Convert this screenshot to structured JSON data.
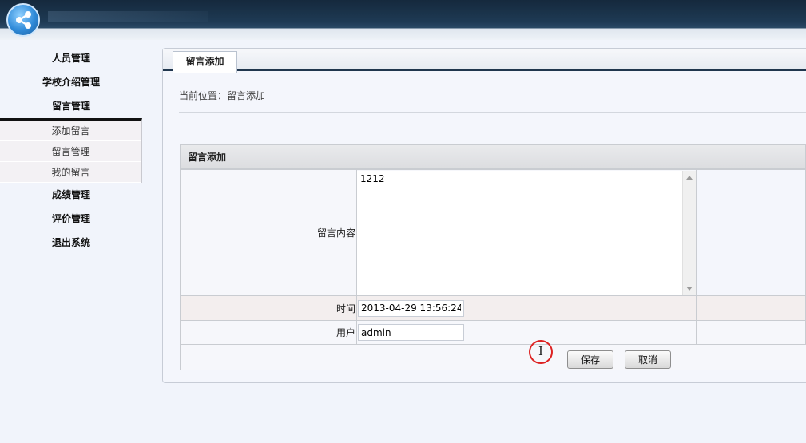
{
  "sidebar": {
    "items_top": [
      {
        "label": "人员管理"
      },
      {
        "label": "学校介绍管理"
      },
      {
        "label": "留言管理"
      }
    ],
    "submenu": [
      {
        "label": "添加留言"
      },
      {
        "label": "留言管理"
      },
      {
        "label": "我的留言"
      }
    ],
    "items_bottom": [
      {
        "label": "成绩管理"
      },
      {
        "label": "评价管理"
      },
      {
        "label": "退出系统"
      }
    ]
  },
  "main": {
    "tab_label": "留言添加",
    "breadcrumb": "当前位置：留言添加",
    "form": {
      "title": "留言添加",
      "content_label": "留言内容",
      "content_value": "1212",
      "time_label": "时间",
      "time_value": "2013-04-29 13:56:24",
      "user_label": "用户",
      "user_value": "admin",
      "save_label": "保存",
      "cancel_label": "取消"
    }
  },
  "cursor_glyph": "I",
  "colors": {
    "header_dark": "#15293d",
    "tab_underline": "#20364e",
    "page_bg": "#f1f4fb",
    "cursor_ring": "#dd2222"
  },
  "icons": {
    "logo": "share-network-icon"
  }
}
